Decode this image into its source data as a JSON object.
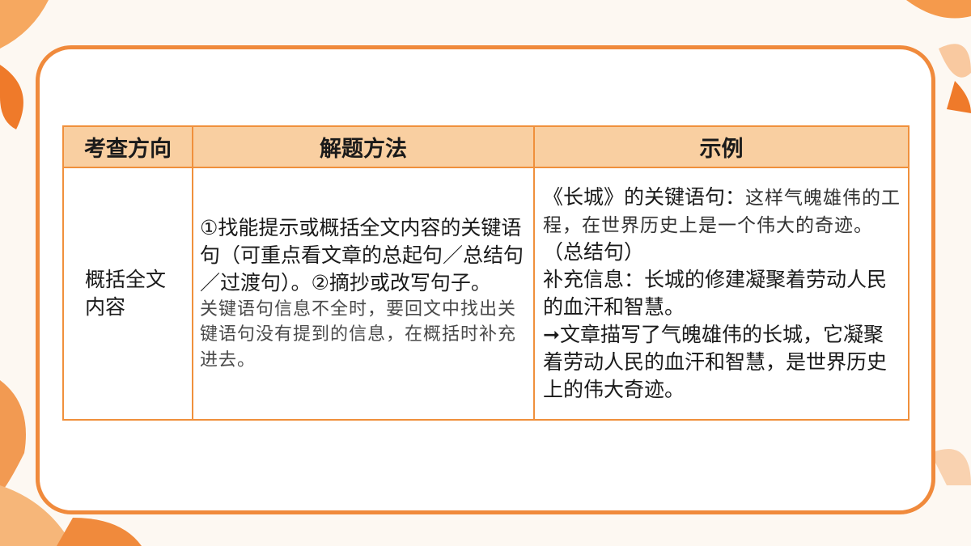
{
  "colors": {
    "accent": "#f08a3c",
    "header_bg": "#f9cfa1",
    "card_bg": "#ffffff",
    "page_bg": "#fdf8f2"
  },
  "table": {
    "headers": [
      "考查方向",
      "解题方法",
      "示例"
    ],
    "row": {
      "direction": "概括全文内容",
      "method": {
        "main": "①找能提示或概括全文内容的关键语句（可重点看文章的总起句／总结句／过渡句）。②摘抄或改写句子。",
        "note": "关键语句信息不全时，要回文中找出关键语句没有提到的信息，在概括时补充进去。"
      },
      "example": {
        "lead": "《长城》的关键语句：",
        "quote": "这样气魄雄伟的工程，在世界历史上是一个伟大的奇迹。",
        "tag": "（总结句）",
        "supplement": "补充信息：长城的修建凝聚着劳动人民的血汗和智慧。",
        "conclusion": "➞文章描写了气魄雄伟的长城，它凝聚着劳动人民的血汗和智慧，是世界历史上的伟大奇迹。"
      }
    }
  }
}
